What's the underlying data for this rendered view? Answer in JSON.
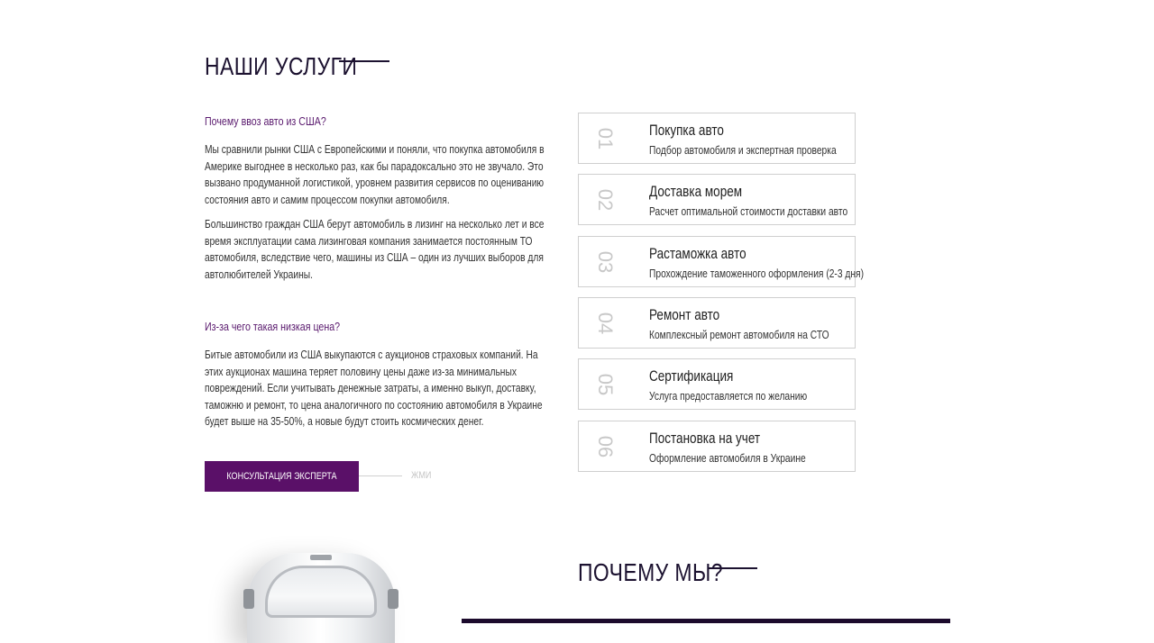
{
  "services_section": {
    "title": "НАШИ УСЛУГИ",
    "q1": "Почему ввоз авто из США?",
    "p1": [
      "Мы сравнили рынки США с Европейскими и поняли, что покупка автомобиля в",
      "Америке выгоднее в несколько раз, как бы парадоксально это не звучало. Это",
      "вызвано продуманной логистикой, уровнем развития сервисов по оцениванию",
      "состояния авто и самим процессом покупки автомобиля."
    ],
    "p2": [
      "Большинство граждан США берут автомобиль в лизинг на несколько лет и все",
      "время эксплуатации сама лизинговая компания занимается постоянным ТО",
      "автомобиля, вследствие чего, машины из США – один из лучших выборов для",
      "автолюбителей Украины."
    ],
    "q2": "Из-за чего такая низкая цена?",
    "p3": [
      "Битые автомобили из США выкупаются с аукционов страховых компаний. На",
      "этих аукционах машина теряет половину цены даже из-за минимальных",
      "повреждений. Если учитывать денежные затраты, а именно выкуп, доставку,",
      "таможню и ремонт, то цена аналогичного по состоянию автомобиля в Украине",
      "будет выше на 35-50%, а новые будут стоить космических денег."
    ],
    "cta_label": "КОНСУЛЬТАЦИЯ ЭКСПЕРТА",
    "cta_hint": "ЖМИ",
    "items": [
      {
        "num": "01",
        "title": "Покупка авто",
        "desc": "Подбор автомобиля и экспертная проверка"
      },
      {
        "num": "02",
        "title": "Доставка морем",
        "desc": "Расчет оптимальной стоимости доставки авто"
      },
      {
        "num": "03",
        "title": "Растаможка авто",
        "desc": "Прохождение таможенного оформления (2-3 дня)"
      },
      {
        "num": "04",
        "title": "Ремонт авто",
        "desc": "Комплексный ремонт автомобиля на СТО"
      },
      {
        "num": "05",
        "title": "Сертификация",
        "desc": "Услуга предоставляется по желанию"
      },
      {
        "num": "06",
        "title": "Постановка на учет",
        "desc": "Оформление автомобиля в Украине"
      }
    ]
  },
  "why_section": {
    "title": "ПОЧЕМУ МЫ?"
  },
  "colors": {
    "accent": "#5a1068",
    "heading": "#1c1230",
    "border": "#cfcfcf",
    "dark_bar": "#1c0a2c"
  }
}
